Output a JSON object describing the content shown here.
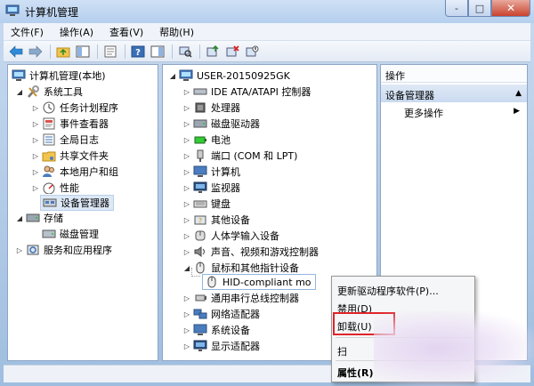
{
  "window": {
    "title": "计算机管理",
    "controls": {
      "minimize": "-",
      "maximize": "□",
      "close": "✕"
    }
  },
  "menubar": {
    "items": [
      "文件(F)",
      "操作(A)",
      "查看(V)",
      "帮助(H)"
    ]
  },
  "left_tree": {
    "root": "计算机管理(本地)",
    "system_tools": "系统工具",
    "children": [
      "任务计划程序",
      "事件查看器",
      "全局日志",
      "共享文件夹",
      "本地用户和组",
      "性能",
      "设备管理器"
    ],
    "storage": "存储",
    "disk_mgmt": "磁盘管理",
    "services": "服务和应用程序"
  },
  "device_tree": {
    "computer": "USER-20150925GK",
    "items": [
      "IDE ATA/ATAPI 控制器",
      "处理器",
      "磁盘驱动器",
      "电池",
      "端口 (COM 和 LPT)",
      "计算机",
      "监视器",
      "键盘",
      "其他设备",
      "人体学输入设备",
      "声音、视频和游戏控制器",
      "鼠标和其他指针设备"
    ],
    "hid_device": "HID-compliant mo",
    "items_after": [
      "通用串行总线控制器",
      "网络适配器",
      "系统设备",
      "显示适配器"
    ]
  },
  "actions": {
    "header": "操作",
    "section": "设备管理器",
    "more": "更多操作"
  },
  "context_menu": {
    "update_driver": "更新驱动程序软件(P)...",
    "disable": "禁用(D)",
    "uninstall": "卸载(U)",
    "scan": "扫",
    "properties": "属性(R)"
  },
  "colors": {
    "highlight_border": "#e0242a",
    "selection": "#dde8f6"
  }
}
